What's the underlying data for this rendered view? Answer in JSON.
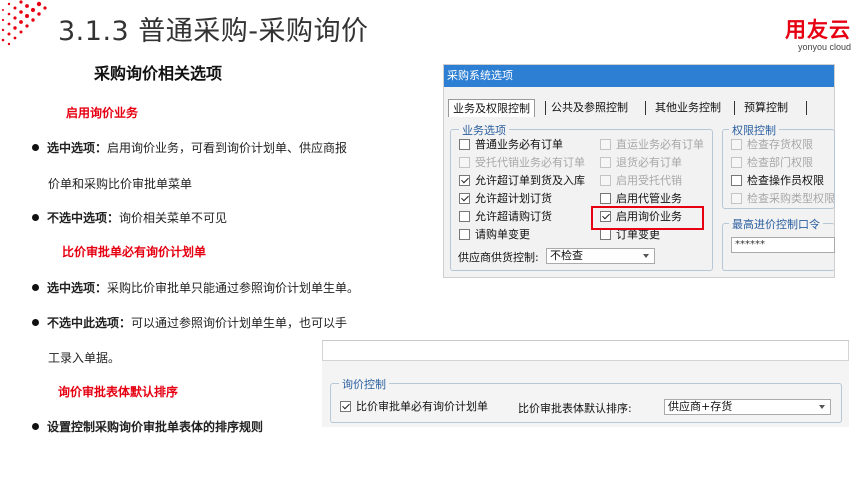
{
  "slide": {
    "title": "3.1.3 普通采购-采购询价",
    "brand_logo": "用友云",
    "brand_sub": "yonyou cloud"
  },
  "left": {
    "section_title": "采购询价相关选项",
    "head1": "启用询价业务",
    "b1_label": "选中选项：",
    "b1_text": "启用询价业务，可看到询价计划单、供应商报",
    "b1_cont": "价单和采购比价审批单菜单",
    "b2_label": "不选中选项：",
    "b2_text": "询价相关菜单不可见",
    "head2": "比价审批单必有询价计划单",
    "b3_label": "选中选项：",
    "b3_text": "采购比价审批单只能通过参照询价计划单生单。",
    "b4_label": "不选中此选项：",
    "b4_text": "可以通过参照询价计划单生单，也可以手",
    "b4_cont": "工录入单据。",
    "head3": "询价审批表体默认排序",
    "b5_text": "设置控制采购询价审批单表体的排序规则"
  },
  "dialog": {
    "title": "采购系统选项",
    "tabs": [
      "业务及权限控制",
      "公共及参照控制",
      "其他业务控制",
      "预算控制"
    ],
    "business_group": "业务选项",
    "col1": [
      {
        "label": "普通业务必有订单",
        "checked": false,
        "disabled": false
      },
      {
        "label": "受托代销业务必有订单",
        "checked": false,
        "disabled": true
      },
      {
        "label": "允许超订单到货及入库",
        "checked": true,
        "disabled": false
      },
      {
        "label": "允许超计划订货",
        "checked": true,
        "disabled": false
      },
      {
        "label": "允许超请购订货",
        "checked": false,
        "disabled": false
      },
      {
        "label": "请购单变更",
        "checked": false,
        "disabled": false
      }
    ],
    "col2": [
      {
        "label": "直运业务必有订单",
        "checked": false,
        "disabled": true
      },
      {
        "label": "退货必有订单",
        "checked": false,
        "disabled": true
      },
      {
        "label": "启用受托代销",
        "checked": false,
        "disabled": true
      },
      {
        "label": "启用代管业务",
        "checked": false,
        "disabled": false
      },
      {
        "label": "启用询价业务",
        "checked": true,
        "disabled": false
      },
      {
        "label": "订单变更",
        "checked": false,
        "disabled": false
      }
    ],
    "supplier_label": "供应商供货控制:",
    "supplier_value": "不检查",
    "perm_group": "权限控制",
    "perm": [
      {
        "label": "检查存货权限",
        "checked": false,
        "disabled": true
      },
      {
        "label": "检查部门权限",
        "checked": false,
        "disabled": true
      },
      {
        "label": "检查操作员权限",
        "checked": false,
        "disabled": false
      },
      {
        "label": "检查采购类型权限",
        "checked": false,
        "disabled": true
      }
    ],
    "max_price_group": "最高进价控制口令",
    "password": "******"
  },
  "inquiry": {
    "group": "询价控制",
    "opt_label": "比价审批单必有询价计划单",
    "opt_checked": true,
    "sort_label": "比价审批表体默认排序:",
    "sort_value": "供应商+存货"
  },
  "colors": {
    "accent_red": "#e60012",
    "titlebar_blue": "#2d7fd3"
  }
}
